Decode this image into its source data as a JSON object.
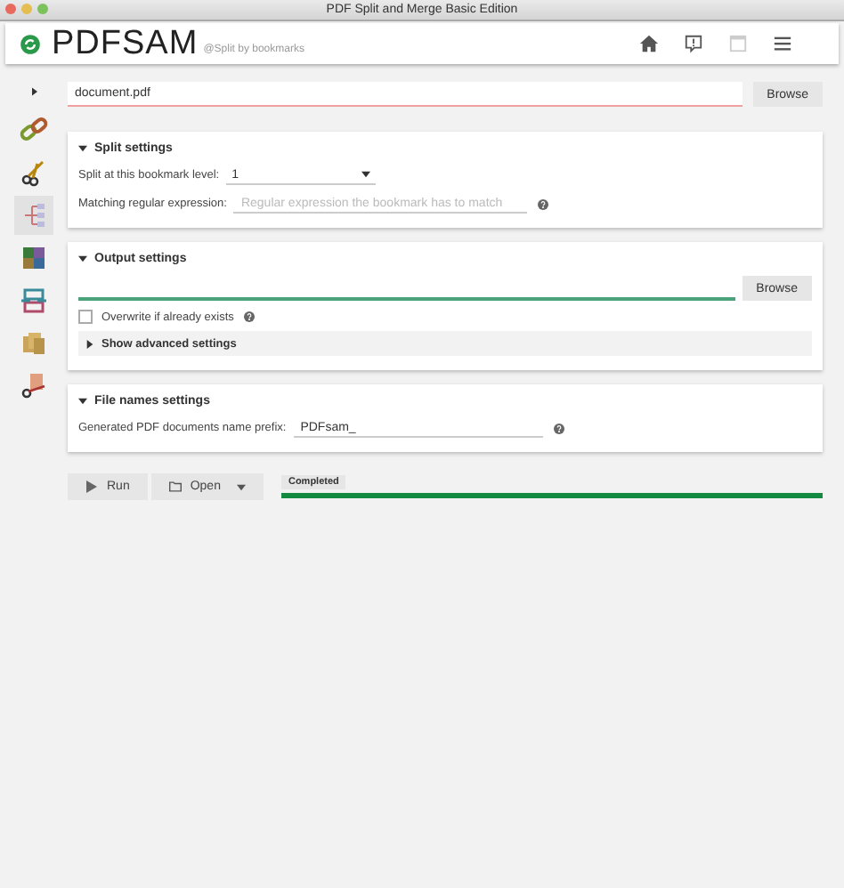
{
  "window": {
    "title": "PDF Split and Merge Basic Edition"
  },
  "header": {
    "logo": "PDFSAM",
    "subtitle": "@Split by bookmarks"
  },
  "sidebar": {
    "items": [
      {
        "kind": "chain",
        "selected": false
      },
      {
        "kind": "scissors",
        "selected": false
      },
      {
        "kind": "tree",
        "selected": true
      },
      {
        "kind": "grid",
        "selected": false
      },
      {
        "kind": "rotate",
        "selected": false
      },
      {
        "kind": "pages",
        "selected": false
      },
      {
        "kind": "cut",
        "selected": false
      }
    ]
  },
  "file": {
    "value": "document.pdf",
    "button": "Browse"
  },
  "split_settings": {
    "title": "Split settings",
    "expanded": true,
    "level_label": "Split at this bookmark level:",
    "level_value": "1",
    "regex_label": "Matching regular expression:",
    "regex_placeholder": "Regular expression the bookmark has to match"
  },
  "output_settings": {
    "title": "Output settings",
    "expanded": true,
    "button": "Browse",
    "overwrite_label": "Overwrite if already exists",
    "overwrite_checked": false,
    "advanced": "Show advanced settings",
    "advanced_expanded": false
  },
  "file_names_settings": {
    "title": "File names settings",
    "expanded": true,
    "prefix_label": "Generated PDF documents name prefix:",
    "prefix_value": "PDFsam_"
  },
  "footer": {
    "run": "Run",
    "open": "Open",
    "status": "Completed",
    "level": 1
  }
}
